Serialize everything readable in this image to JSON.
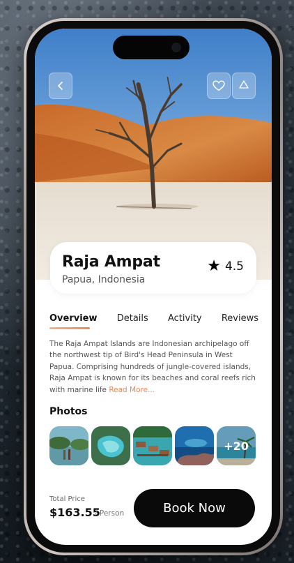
{
  "destination": {
    "title": "Raja Ampat",
    "location": "Papua, Indonesia",
    "rating": "4.5"
  },
  "tabs": [
    {
      "label": "Overview",
      "active": true
    },
    {
      "label": "Details",
      "active": false
    },
    {
      "label": "Activity",
      "active": false
    },
    {
      "label": "Reviews",
      "active": false
    }
  ],
  "description": {
    "text": "The Raja Ampat Islands are Indonesian archipelago off the northwest tip of Bird's Head Peninsula in West Papua. Comprising hundreds of jungle-covered islands, Raja Ampat is known for its beaches and coral reefs rich with marine life",
    "read_more": "Read More..."
  },
  "photos": {
    "title": "Photos",
    "more_count": "+20"
  },
  "footer": {
    "price_label": "Total Price",
    "price": "$163.55",
    "per": "/ Person",
    "book_label": "Book Now"
  },
  "icons": {
    "back": "chevron-left-icon",
    "favorite": "heart-icon",
    "share": "recycle-share-icon",
    "rating": "star-icon"
  },
  "colors": {
    "accent": "#e8895a",
    "button": "#0a0a0a"
  }
}
